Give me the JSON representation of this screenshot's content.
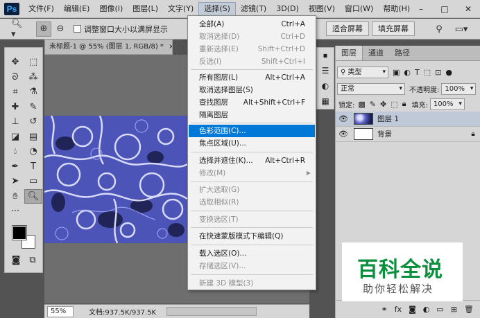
{
  "app": {
    "logo": "Ps"
  },
  "menubar": {
    "items": [
      "文件(F)",
      "编辑(E)",
      "图像(I)",
      "图层(L)",
      "文字(Y)",
      "选择(S)",
      "滤镜(T)",
      "3D(D)",
      "视图(V)",
      "窗口(W)",
      "帮助(H)"
    ],
    "active_index": 5
  },
  "window": {
    "minimize": "–",
    "maximize": "□",
    "close": "✕"
  },
  "options_bar": {
    "zoom_icon": "zoom-icon",
    "checkbox_label": "调整窗口大小以满屏显示",
    "fit_screen": "适合屏幕",
    "fill_screen": "填充屏幕"
  },
  "document": {
    "tab_title": "未标题-1 @ 55% (图层 1, RGB/8) *",
    "tab_close": "×",
    "zoom_level": "55%",
    "doc_info": "文档:937.5K/937.5K"
  },
  "select_menu": {
    "items": [
      {
        "label": "全部(A)",
        "shortcut": "Ctrl+A",
        "disabled": false
      },
      {
        "label": "取消选择(D)",
        "shortcut": "Ctrl+D",
        "disabled": true
      },
      {
        "label": "重新选择(E)",
        "shortcut": "Shift+Ctrl+D",
        "disabled": true
      },
      {
        "label": "反选(I)",
        "shortcut": "Shift+Ctrl+I",
        "disabled": true
      },
      {
        "label": "所有图层(L)",
        "shortcut": "Alt+Ctrl+A",
        "disabled": false
      },
      {
        "label": "取消选择图层(S)",
        "shortcut": "",
        "disabled": false
      },
      {
        "label": "查找图层",
        "shortcut": "Alt+Shift+Ctrl+F",
        "disabled": false
      },
      {
        "label": "隔离图层",
        "shortcut": "",
        "disabled": false
      },
      {
        "label": "色彩范围(C)...",
        "shortcut": "",
        "disabled": false,
        "highlighted": true
      },
      {
        "label": "焦点区域(U)...",
        "shortcut": "",
        "disabled": false
      },
      {
        "label": "选择并遮住(K)...",
        "shortcut": "Alt+Ctrl+R",
        "disabled": false
      },
      {
        "label": "修改(M)",
        "shortcut": "",
        "disabled": true,
        "submenu": true
      },
      {
        "label": "扩大选取(G)",
        "shortcut": "",
        "disabled": true
      },
      {
        "label": "选取相似(R)",
        "shortcut": "",
        "disabled": true
      },
      {
        "label": "变换选区(T)",
        "shortcut": "",
        "disabled": true
      },
      {
        "label": "在快速蒙版模式下编辑(Q)",
        "shortcut": "",
        "disabled": false
      },
      {
        "label": "载入选区(O)...",
        "shortcut": "",
        "disabled": false
      },
      {
        "label": "存储选区(V)...",
        "shortcut": "",
        "disabled": true
      },
      {
        "label": "新建 3D 模型(3)",
        "shortcut": "",
        "disabled": true
      }
    ]
  },
  "layers_panel": {
    "tabs": [
      "图层",
      "通道",
      "路径"
    ],
    "active_tab": 0,
    "filter_kind": "类型",
    "blend_mode": "正常",
    "opacity_label": "不透明度:",
    "opacity_value": "100%",
    "lock_label": "锁定:",
    "fill_label": "填充:",
    "fill_value": "100%",
    "layers": [
      {
        "name": "图层 1",
        "selected": true,
        "locked": false
      },
      {
        "name": "背景",
        "selected": false,
        "locked": true
      }
    ]
  },
  "watermark": {
    "title": "百科全说",
    "subtitle": "助你轻松解决"
  },
  "colors": {
    "highlight": "#0078d7",
    "canvas_base": "#5a61c8",
    "watermark_green": "#0a8f3c"
  }
}
